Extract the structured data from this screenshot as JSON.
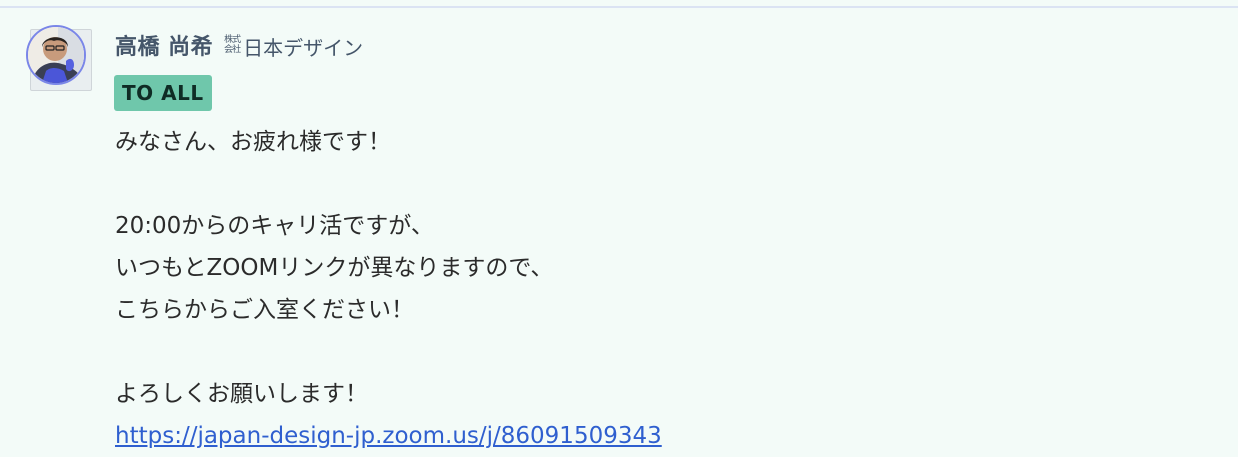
{
  "message": {
    "sender": {
      "name": "高橋 尚希",
      "corp_mark": "株式会社",
      "company": "日本デザイン"
    },
    "badge": "TO ALL",
    "lines": [
      "みなさん、お疲れ様です！",
      "",
      "20:00からのキャリ活ですが、",
      "いつもとZOOMリンクが異なりますので、",
      "こちらからご入室ください！",
      "",
      "よろしくお願いします！"
    ],
    "link": "https://japan-design-jp.zoom.us/j/86091509343"
  }
}
